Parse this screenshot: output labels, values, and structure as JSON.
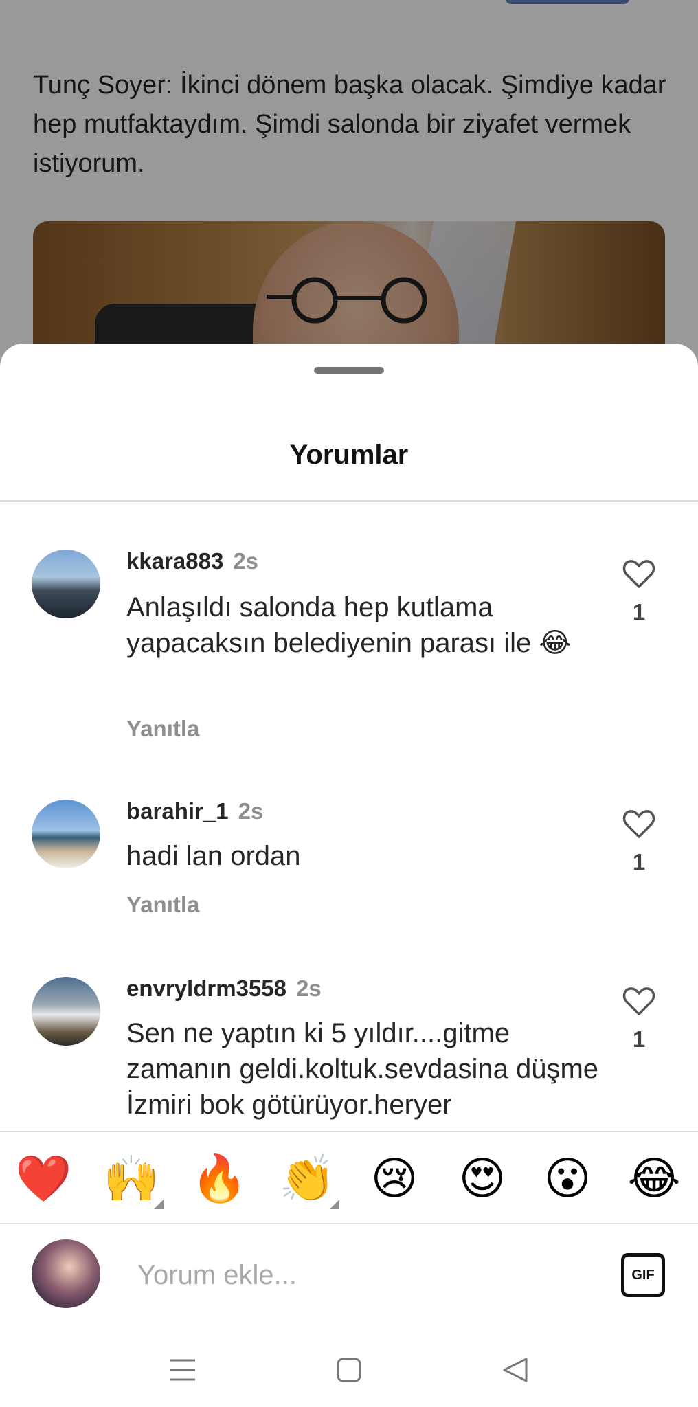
{
  "post": {
    "caption": "Tunç Soyer: İkinci dönem başka olacak. Şimdiye kadar hep mutfaktaydım. Şimdi salonda bir ziyafet vermek istiyorum."
  },
  "sheet": {
    "title": "Yorumlar"
  },
  "comments": [
    {
      "username": "kkara883",
      "time": "2s",
      "text": "Anlaşıldı salonda hep kutlama yapacaksın belediyenin parası ile 😂",
      "reply_label": "Yanıtla",
      "likes": "1"
    },
    {
      "username": "barahir_1",
      "time": "2s",
      "text": "hadi lan ordan",
      "reply_label": "Yanıtla",
      "likes": "1"
    },
    {
      "username": "envryldrm3558",
      "time": "2s",
      "text": "Sen ne yaptın ki 5 yıldır....gitme zamanın geldi.koltuk.sevdasina düşme İzmiri bok götürüyor.heryer",
      "likes": "1"
    }
  ],
  "emoji_bar": [
    "❤️",
    "🙌",
    "🔥",
    "👏",
    "😢",
    "😍",
    "😮",
    "😂"
  ],
  "composer": {
    "placeholder": "Yorum ekle...",
    "gif_label": "GIF"
  },
  "navbar": {
    "icons": [
      "menu-icon",
      "home-square-icon",
      "back-triangle-icon"
    ]
  }
}
